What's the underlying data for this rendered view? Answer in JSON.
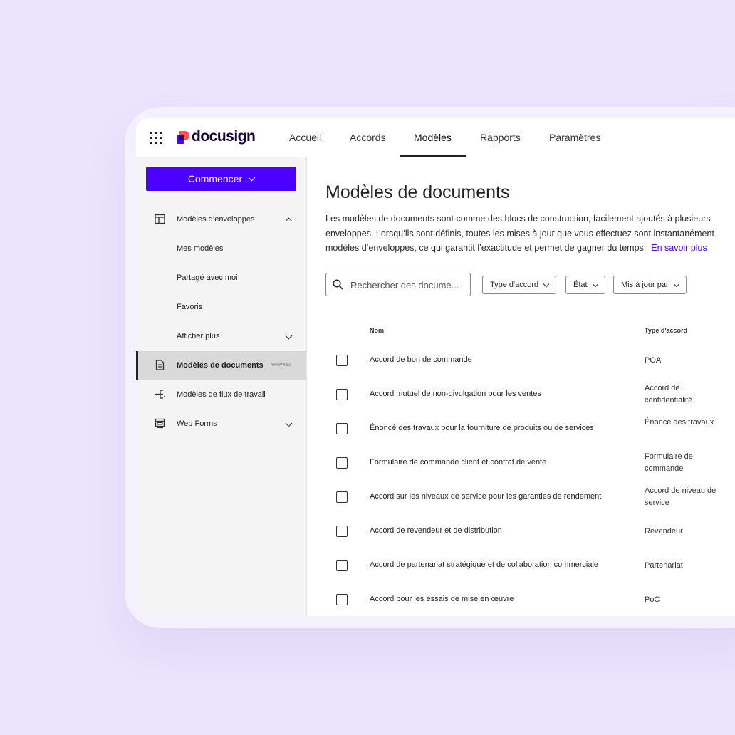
{
  "brand": {
    "name": "docusign"
  },
  "nav": {
    "tabs": [
      "Accueil",
      "Accords",
      "Modèles",
      "Rapports",
      "Paramètres"
    ],
    "active": "Modèles"
  },
  "sidebar": {
    "start_label": "Commencer",
    "items": [
      {
        "label": "Modèles d’enveloppes",
        "icon": "layout-icon",
        "caret": "up"
      },
      {
        "label": "Mes modèles"
      },
      {
        "label": "Partagé avec moi"
      },
      {
        "label": "Favoris"
      },
      {
        "label": "Afficher plus",
        "caret": "down"
      },
      {
        "label": "Modèles de documents",
        "icon": "document-icon",
        "badge": "Nouveau",
        "active": true
      },
      {
        "label": "Modèles de flux de travail",
        "icon": "workflow-icon"
      },
      {
        "label": "Web Forms",
        "icon": "webform-icon",
        "caret": "down"
      }
    ]
  },
  "main": {
    "title": "Modèles de documents",
    "description_lines": [
      "Les modèles de documents sont comme des blocs de construction, facilement ajoutés à plusieurs",
      "enveloppes. Lorsqu’ils sont définis, toutes les mises à jour que vous effectuez sont instantanément",
      "modèles d’enveloppes, ce qui garantit l’exactitude et permet de gagner du temps."
    ],
    "learn_more": "En savoir plus",
    "search_placeholder": "Rechercher des docume...",
    "filters": [
      "Type d'accord",
      "État",
      "Mis à jour par"
    ],
    "columns": {
      "name": "Nom",
      "type": "Type d'accord"
    },
    "rows": [
      {
        "name": "Accord de bon de commande",
        "type": "POA"
      },
      {
        "name": "Accord mutuel de non-divulgation pour les ventes",
        "type": "Accord de confidentialité"
      },
      {
        "name": "Énoncé des travaux pour la fourniture de produits ou de services",
        "type": "Énoncé des travaux"
      },
      {
        "name": "Formulaire de commande client et contrat de vente",
        "type": "Formulaire de commande"
      },
      {
        "name": "Accord sur les niveaux de service pour les garanties de rendement",
        "type": "Accord de niveau de service"
      },
      {
        "name": "Accord de revendeur et de distribution",
        "type": "Revendeur"
      },
      {
        "name": "Accord de partenariat stratégique et de collaboration commerciale",
        "type": "Partenariat"
      },
      {
        "name": "Accord pour les essais de mise en œuvre",
        "type": "PoC"
      }
    ]
  },
  "colors": {
    "accent": "#4c00ff",
    "background": "#ebe4fd",
    "logo_red": "#ff5252"
  }
}
